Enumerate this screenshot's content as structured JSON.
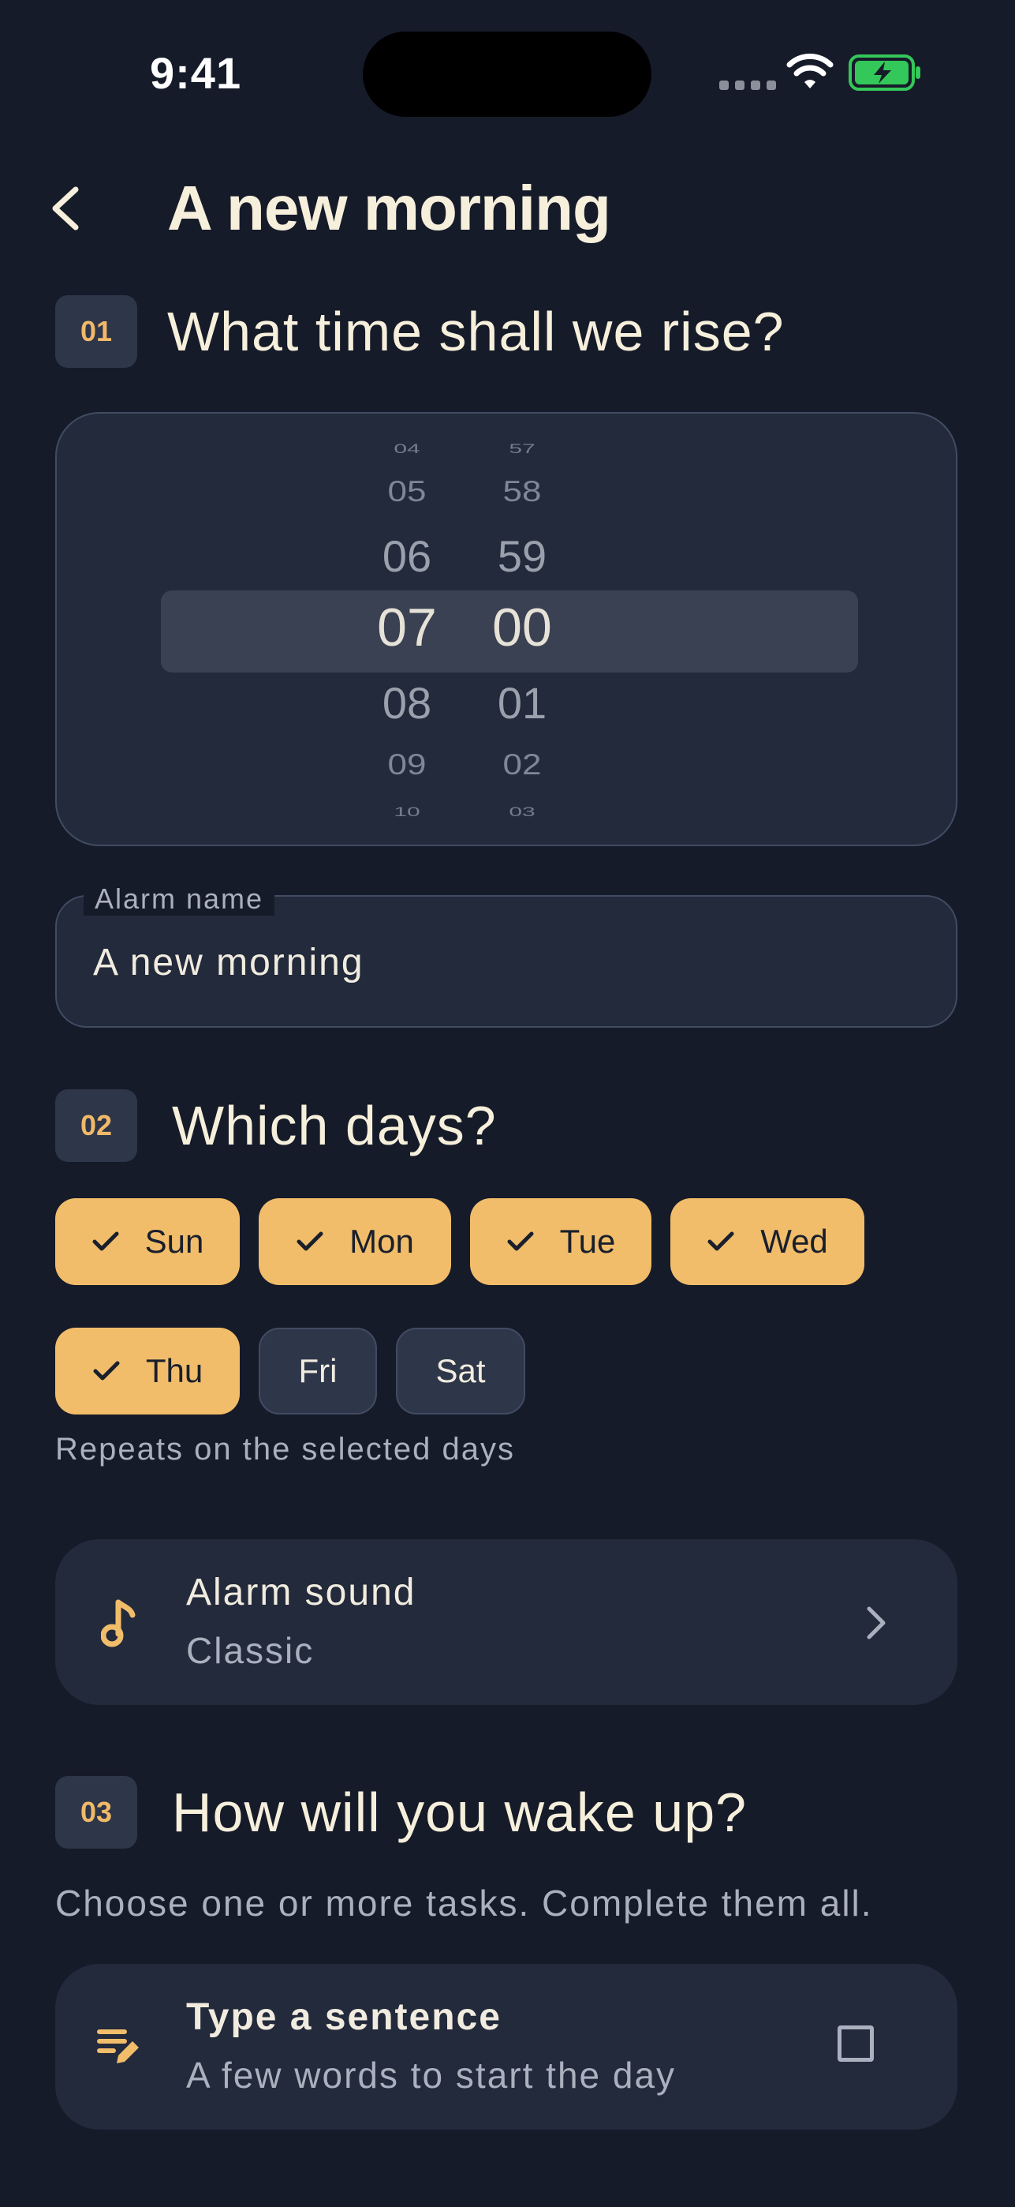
{
  "status_bar": {
    "time": "9:41"
  },
  "header": {
    "title": "A new morning"
  },
  "sections": [
    {
      "number": "01",
      "title": "What time shall we rise?"
    },
    {
      "number": "02",
      "title": "Which days?"
    },
    {
      "number": "03",
      "title": "How will you wake up?"
    }
  ],
  "time_picker": {
    "hours": [
      "04",
      "05",
      "06",
      "07",
      "08",
      "09",
      "10"
    ],
    "minutes": [
      "57",
      "58",
      "59",
      "00",
      "01",
      "02",
      "03"
    ],
    "selected_hour": "07",
    "selected_minute": "00"
  },
  "alarm_name": {
    "label": "Alarm name",
    "value": "A new morning"
  },
  "days": [
    {
      "label": "Sun",
      "selected": true
    },
    {
      "label": "Mon",
      "selected": true
    },
    {
      "label": "Tue",
      "selected": true
    },
    {
      "label": "Wed",
      "selected": true
    },
    {
      "label": "Thu",
      "selected": true
    },
    {
      "label": "Fri",
      "selected": false
    },
    {
      "label": "Sat",
      "selected": false
    }
  ],
  "days_hint": "Repeats on the selected days",
  "alarm_sound": {
    "title": "Alarm sound",
    "value": "Classic",
    "icon": "music-note-icon"
  },
  "tasks_hint": "Choose one or more tasks. Complete them all.",
  "tasks": [
    {
      "title": "Type a sentence",
      "subtitle": "A few words to start the day",
      "icon": "edit-note-icon",
      "checked": false
    }
  ],
  "colors": {
    "background": "#161b29",
    "surface": "#222a3b",
    "accent": "#f1bd6a",
    "badge": "#2e3649",
    "battery": "#34c759"
  }
}
